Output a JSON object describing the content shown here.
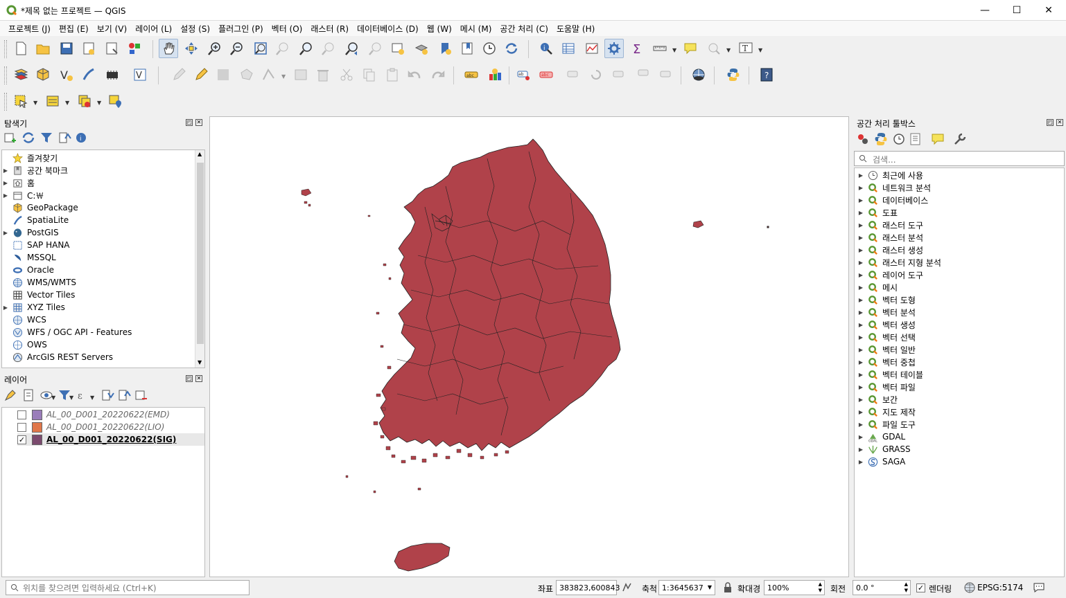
{
  "window": {
    "title": "*제목 없는 프로젝트 — QGIS",
    "minimize": "—",
    "maximize": "☐",
    "close": "✕"
  },
  "menu": [
    "프로젝트 (J)",
    "편집 (E)",
    "보기 (V)",
    "레이어 (L)",
    "설정 (S)",
    "플러그인 (P)",
    "벡터 (O)",
    "래스터 (R)",
    "데이터베이스 (D)",
    "웹 (W)",
    "메시 (M)",
    "공간 처리 (C)",
    "도움말 (H)"
  ],
  "browser": {
    "title": "탐색기",
    "items": [
      {
        "label": "즐겨찾기",
        "icon": "star-icon",
        "expandable": false
      },
      {
        "label": "공간 북마크",
        "icon": "bookmark-icon",
        "expandable": true
      },
      {
        "label": "홈",
        "icon": "home-icon",
        "expandable": true
      },
      {
        "label": "C:￦",
        "icon": "drive-icon",
        "expandable": true
      },
      {
        "label": "GeoPackage",
        "icon": "geopackage-icon",
        "expandable": false
      },
      {
        "label": "SpatiaLite",
        "icon": "spatialite-icon",
        "expandable": false
      },
      {
        "label": "PostGIS",
        "icon": "postgis-icon",
        "expandable": true
      },
      {
        "label": "SAP HANA",
        "icon": "sap-hana-icon",
        "expandable": false
      },
      {
        "label": "MSSQL",
        "icon": "mssql-icon",
        "expandable": false
      },
      {
        "label": "Oracle",
        "icon": "oracle-icon",
        "expandable": false
      },
      {
        "label": "WMS/WMTS",
        "icon": "wms-icon",
        "expandable": false
      },
      {
        "label": "Vector Tiles",
        "icon": "vector-tiles-icon",
        "expandable": false
      },
      {
        "label": "XYZ Tiles",
        "icon": "xyz-tiles-icon",
        "expandable": true
      },
      {
        "label": "WCS",
        "icon": "wcs-icon",
        "expandable": false
      },
      {
        "label": "WFS / OGC API - Features",
        "icon": "wfs-icon",
        "expandable": false
      },
      {
        "label": "OWS",
        "icon": "ows-icon",
        "expandable": false
      },
      {
        "label": "ArcGIS REST Servers",
        "icon": "arcgis-icon",
        "expandable": false
      }
    ]
  },
  "layers": {
    "title": "레이어",
    "items": [
      {
        "label": "AL_00_D001_20220622(EMD)",
        "checked": false,
        "color": "#9a7dba"
      },
      {
        "label": "AL_00_D001_20220622(LIO)",
        "checked": false,
        "color": "#e0774a"
      },
      {
        "label": "AL_00_D001_20220622(SIG)",
        "checked": true,
        "color": "#7b4a6e"
      }
    ]
  },
  "processing": {
    "title": "공간 처리 툴박스",
    "search_placeholder": "검색...",
    "items": [
      {
        "label": "최근에 사용",
        "icon": "clock-icon"
      },
      {
        "label": "네트워크 분석",
        "icon": "qgis-icon"
      },
      {
        "label": "데이터베이스",
        "icon": "qgis-icon"
      },
      {
        "label": "도표",
        "icon": "qgis-icon"
      },
      {
        "label": "래스터 도구",
        "icon": "qgis-icon"
      },
      {
        "label": "래스터 분석",
        "icon": "qgis-icon"
      },
      {
        "label": "래스터 생성",
        "icon": "qgis-icon"
      },
      {
        "label": "래스터 지형 분석",
        "icon": "qgis-icon"
      },
      {
        "label": "레이어 도구",
        "icon": "qgis-icon"
      },
      {
        "label": "메시",
        "icon": "qgis-icon"
      },
      {
        "label": "벡터 도형",
        "icon": "qgis-icon"
      },
      {
        "label": "벡터 분석",
        "icon": "qgis-icon"
      },
      {
        "label": "벡터 생성",
        "icon": "qgis-icon"
      },
      {
        "label": "벡터 선택",
        "icon": "qgis-icon"
      },
      {
        "label": "벡터 일반",
        "icon": "qgis-icon"
      },
      {
        "label": "벡터 중첩",
        "icon": "qgis-icon"
      },
      {
        "label": "벡터 테이블",
        "icon": "qgis-icon"
      },
      {
        "label": "벡터 파일",
        "icon": "qgis-icon"
      },
      {
        "label": "보간",
        "icon": "qgis-icon"
      },
      {
        "label": "지도 제작",
        "icon": "qgis-icon"
      },
      {
        "label": "파일 도구",
        "icon": "qgis-icon"
      },
      {
        "label": "GDAL",
        "icon": "gdal-icon"
      },
      {
        "label": "GRASS",
        "icon": "grass-icon"
      },
      {
        "label": "SAGA",
        "icon": "saga-icon"
      }
    ]
  },
  "map": {
    "fill": "#b0424a",
    "stroke": "#222222"
  },
  "status": {
    "locator_placeholder": "위치를 찾으려면 입력하세요 (Ctrl+K)",
    "coord_label": "좌표",
    "coord_value": "383823,600843",
    "scale_label": "축척",
    "scale_value": "1:3645637",
    "magnifier_label": "확대경",
    "magnifier_value": "100%",
    "rotation_label": "회전",
    "rotation_value": "0.0 °",
    "render_label": "렌더링",
    "crs": "EPSG:5174"
  }
}
